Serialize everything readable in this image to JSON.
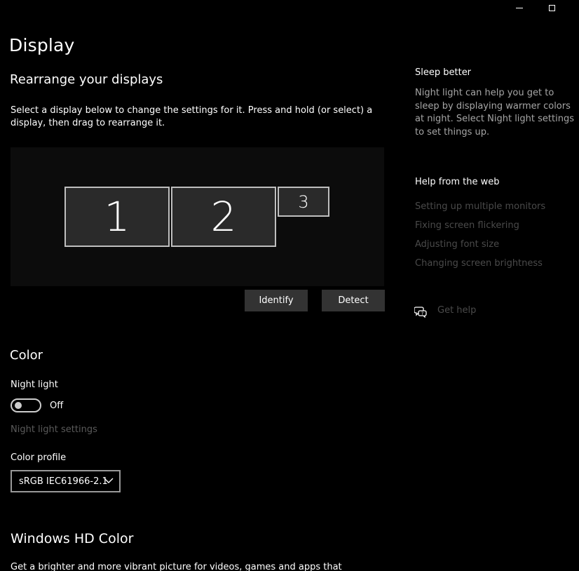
{
  "window": {
    "minimize_icon": "minimize-icon",
    "maximize_icon": "maximize-icon"
  },
  "page": {
    "title": "Display"
  },
  "rearrange": {
    "title": "Rearrange your displays",
    "description": "Select a display below to change the settings for it. Press and hold (or select) a display, then drag to rearrange it.",
    "monitors": [
      "1",
      "2",
      "3"
    ],
    "identify_label": "Identify",
    "detect_label": "Detect"
  },
  "color": {
    "title": "Color",
    "night_light_label": "Night light",
    "night_light_state": "Off",
    "night_light_on": false,
    "night_light_settings_link": "Night light settings",
    "color_profile_label": "Color profile",
    "color_profile_value": "sRGB IEC61966-2.1"
  },
  "hd_color": {
    "title": "Windows HD Color",
    "description": "Get a brighter and more vibrant picture for videos, games and apps that"
  },
  "sidebar": {
    "sleep_title": "Sleep better",
    "sleep_description": "Night light can help you get to sleep by displaying warmer colors at night. Select Night light settings to set things up.",
    "help_title": "Help from the web",
    "help_links": [
      "Setting up multiple monitors",
      "Fixing screen flickering",
      "Adjusting font size",
      "Changing screen brightness"
    ],
    "get_help_label": "Get help",
    "get_help_icon": "chat-help-icon"
  },
  "colors": {
    "background": "#000000",
    "monitor_fill": "#2a2a2a",
    "button_fill": "#333333",
    "dim_link": "#5a5a5a"
  }
}
